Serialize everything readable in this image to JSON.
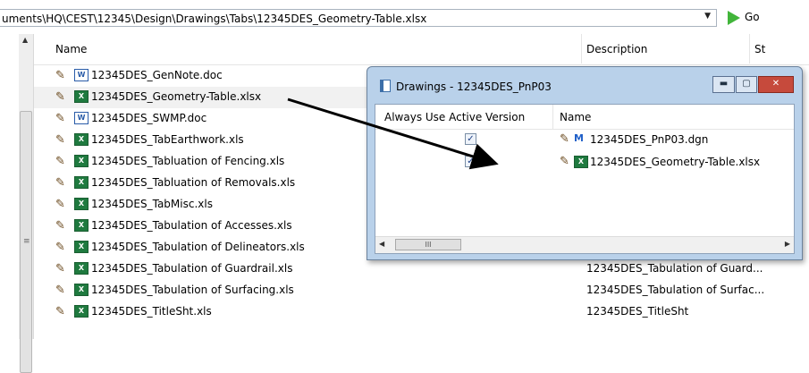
{
  "address_bar": {
    "path": "uments\\HQ\\CEST\\12345\\Design\\Drawings\\Tabs\\12345DES_Geometry-Table.xlsx",
    "go_label": "Go"
  },
  "columns": {
    "name": "Name",
    "description": "Description",
    "status": "St"
  },
  "files": [
    {
      "name": "12345DES_GenNote.doc",
      "type": "doc",
      "description": ""
    },
    {
      "name": "12345DES_Geometry-Table.xlsx",
      "type": "xls",
      "description": ""
    },
    {
      "name": "12345DES_SWMP.doc",
      "type": "doc",
      "description": ""
    },
    {
      "name": "12345DES_TabEarthwork.xls",
      "type": "xls",
      "description": ""
    },
    {
      "name": "12345DES_Tabluation of Fencing.xls",
      "type": "xls",
      "description": ""
    },
    {
      "name": "12345DES_Tabluation of Removals.xls",
      "type": "xls",
      "description": ""
    },
    {
      "name": "12345DES_TabMisc.xls",
      "type": "xls",
      "description": ""
    },
    {
      "name": "12345DES_Tabulation of Accesses.xls",
      "type": "xls",
      "description": ""
    },
    {
      "name": "12345DES_Tabulation of Delineators.xls",
      "type": "xls",
      "description": ""
    },
    {
      "name": "12345DES_Tabulation of Guardrail.xls",
      "type": "xls",
      "description": "12345DES_Tabulation of Guard..."
    },
    {
      "name": "12345DES_Tabulation of Surfacing.xls",
      "type": "xls",
      "description": "12345DES_Tabulation of Surfac..."
    },
    {
      "name": "12345DES_TitleSht.xls",
      "type": "xls",
      "description": "12345DES_TitleSht"
    }
  ],
  "dialog": {
    "title": "Drawings - 12345DES_PnP03",
    "col_active": "Always Use Active Version",
    "col_name": "Name",
    "items": [
      {
        "name": "12345DES_PnP03.dgn",
        "checked": true,
        "type": "dgn"
      },
      {
        "name": "12345DES_Geometry-Table.xlsx",
        "checked": true,
        "type": "xls"
      }
    ]
  },
  "icons": {
    "pencil": "pencil-icon",
    "excel": "excel-file-icon",
    "word": "word-file-icon",
    "dgn": "microstation-dgn-icon",
    "go": "go-arrow-icon"
  }
}
